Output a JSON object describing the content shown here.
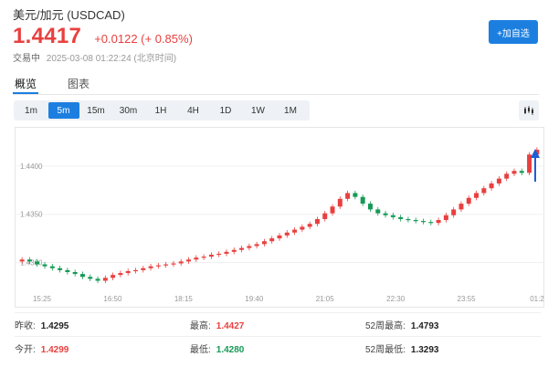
{
  "header": {
    "title": "美元/加元 (USDCAD)",
    "price": "1.4417",
    "change": "+0.0122 (+ 0.85%)",
    "status": "交易中",
    "timestamp": "2025-03-08 01:22:24 (北京时间)",
    "add_button": "+加自选"
  },
  "tabs": [
    {
      "label": "概览",
      "active": true
    },
    {
      "label": "图表",
      "active": false
    }
  ],
  "periods": [
    {
      "label": "1m",
      "active": false
    },
    {
      "label": "5m",
      "active": true
    },
    {
      "label": "15m",
      "active": false
    },
    {
      "label": "30m",
      "active": false
    },
    {
      "label": "1H",
      "active": false
    },
    {
      "label": "4H",
      "active": false
    },
    {
      "label": "1D",
      "active": false
    },
    {
      "label": "1W",
      "active": false
    },
    {
      "label": "1M",
      "active": false
    }
  ],
  "chart_icon": "candlestick-settings-icon",
  "colors": {
    "up": "#e8403f",
    "down": "#159a55",
    "accent": "#1c7fe0",
    "arrow": "#1c5fd6"
  },
  "chart_data": {
    "type": "candlestick",
    "y_ticks": [
      "1.4400",
      "1.4350",
      "1.4300"
    ],
    "y_tick_values": [
      1.44,
      1.435,
      1.43
    ],
    "x_ticks": [
      "15:25",
      "16:50",
      "18:15",
      "19:40",
      "21:05",
      "22:30",
      "23:55",
      "01:2"
    ],
    "ylim": [
      1.4272,
      1.4435
    ],
    "closes": [
      1.4303,
      1.4301,
      1.4298,
      1.4296,
      1.4294,
      1.4292,
      1.429,
      1.4288,
      1.4285,
      1.4283,
      1.4281,
      1.4284,
      1.4287,
      1.4289,
      1.4291,
      1.4292,
      1.4294,
      1.4296,
      1.4297,
      1.4298,
      1.4299,
      1.4301,
      1.4303,
      1.4305,
      1.4306,
      1.4308,
      1.4309,
      1.4311,
      1.4313,
      1.4315,
      1.4317,
      1.4319,
      1.4322,
      1.4325,
      1.4328,
      1.4331,
      1.4334,
      1.4337,
      1.434,
      1.4345,
      1.4351,
      1.4358,
      1.4366,
      1.4372,
      1.4368,
      1.4361,
      1.4355,
      1.4351,
      1.4349,
      1.4347,
      1.4345,
      1.4344,
      1.4343,
      1.4342,
      1.4341,
      1.4344,
      1.4349,
      1.4355,
      1.4361,
      1.4367,
      1.4372,
      1.4377,
      1.4382,
      1.4387,
      1.4392,
      1.4395,
      1.4393,
      1.4412,
      1.4417
    ]
  },
  "annotation": {
    "marker": "up-arrow-icon"
  },
  "stats": [
    [
      {
        "label": "昨收:",
        "value": "1.4295",
        "tone": "blk"
      },
      {
        "label": "最高:",
        "value": "1.4427",
        "tone": "red"
      },
      {
        "label": "52周最高:",
        "value": "1.4793",
        "tone": "blk"
      }
    ],
    [
      {
        "label": "今开:",
        "value": "1.4299",
        "tone": "red"
      },
      {
        "label": "最低:",
        "value": "1.4280",
        "tone": "green"
      },
      {
        "label": "52周最低:",
        "value": "1.3293",
        "tone": "blk"
      }
    ]
  ]
}
